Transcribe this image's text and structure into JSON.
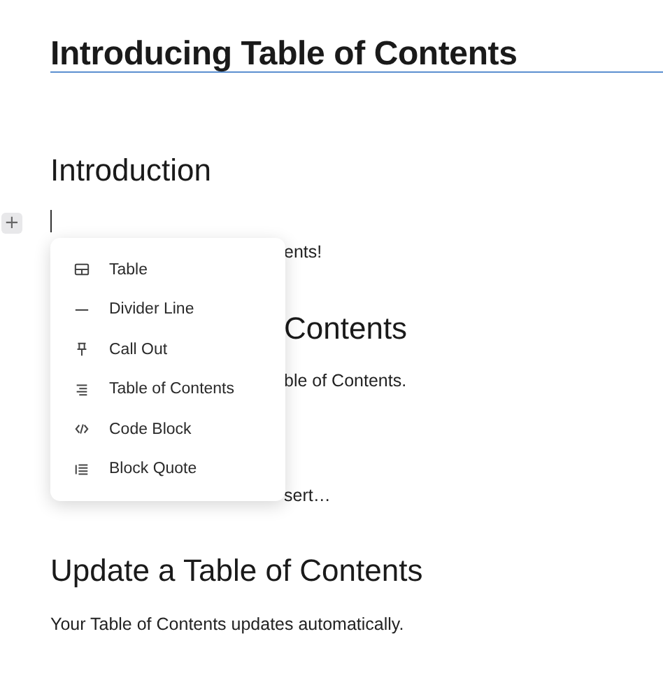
{
  "document": {
    "title": "Introducing Table of Contents",
    "blocks": [
      {
        "kind": "heading",
        "text": "Introduction"
      },
      {
        "kind": "cursor"
      },
      {
        "kind": "clipped",
        "text": "ents!"
      },
      {
        "kind": "clipped_heading",
        "text": "Contents"
      },
      {
        "kind": "clipped",
        "text": "ble of Contents."
      },
      {
        "kind": "clipped",
        "text": "sert…"
      },
      {
        "kind": "heading",
        "text": "Update a Table of Contents"
      },
      {
        "kind": "paragraph",
        "text": "Your Table of Contents updates automatically."
      }
    ]
  },
  "add_button": {
    "label": "+"
  },
  "insert_menu": {
    "items": [
      {
        "kind": "table",
        "label": "Table"
      },
      {
        "kind": "divider",
        "label": "Divider Line"
      },
      {
        "kind": "callout",
        "label": "Call Out"
      },
      {
        "kind": "toc",
        "label": "Table of Contents"
      },
      {
        "kind": "code",
        "label": "Code Block"
      },
      {
        "kind": "quote",
        "label": "Block Quote"
      }
    ]
  }
}
